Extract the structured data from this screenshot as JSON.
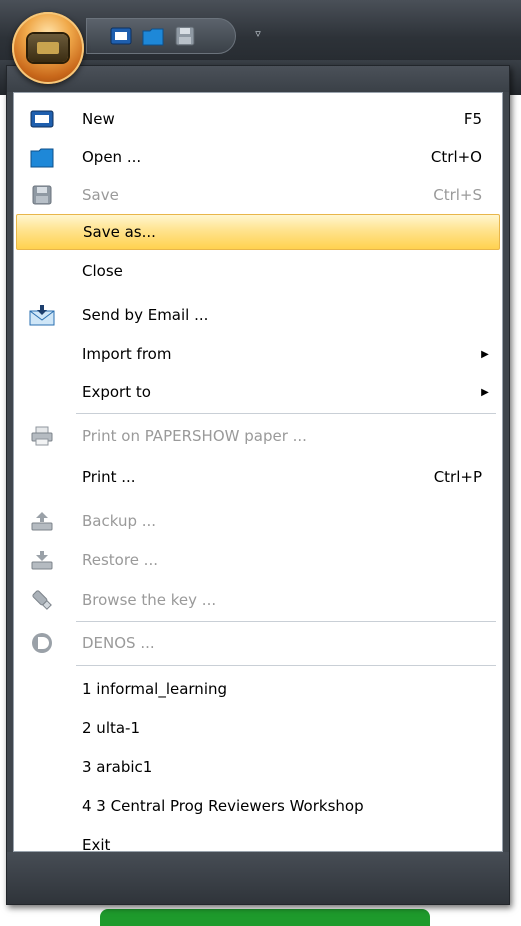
{
  "app": {
    "colors": {
      "highlight": "#ffd24f",
      "chrome": "#2d3238",
      "disabled_text": "#9a9a9a"
    }
  },
  "quick_access": {
    "buttons": [
      {
        "icon": "new-document-icon"
      },
      {
        "icon": "open-folder-icon"
      },
      {
        "icon": "save-disk-icon"
      }
    ],
    "dropdown_icon": "customize-toolbar-arrow-icon"
  },
  "menu": {
    "items": [
      {
        "label": "New",
        "shortcut": "F5",
        "icon": "new-document-icon",
        "enabled": true
      },
      {
        "label": "Open ...",
        "shortcut": "Ctrl+O",
        "icon": "open-folder-icon",
        "enabled": true
      },
      {
        "label": "Save",
        "shortcut": "Ctrl+S",
        "icon": "save-disk-icon",
        "enabled": false
      },
      {
        "label": "Save as...",
        "shortcut": "",
        "enabled": true,
        "highlighted": true
      },
      {
        "label": "Close",
        "shortcut": "",
        "enabled": true
      },
      {
        "label": "Send by Email ...",
        "shortcut": "",
        "icon": "email-icon",
        "enabled": true
      },
      {
        "label": "Import from",
        "submenu": true,
        "enabled": true
      },
      {
        "label": "Export to",
        "submenu": true,
        "enabled": true
      },
      {
        "label": "Print on PAPERSHOW paper ...",
        "icon": "printer-icon",
        "enabled": false
      },
      {
        "label": "Print ...",
        "shortcut": "Ctrl+P",
        "enabled": true
      },
      {
        "label": "Backup ...",
        "icon": "backup-icon",
        "enabled": false
      },
      {
        "label": "Restore ...",
        "icon": "restore-icon",
        "enabled": false
      },
      {
        "label": "Browse the key ...",
        "icon": "usb-key-icon",
        "enabled": false
      },
      {
        "label": "DENOS ...",
        "icon": "denos-icon",
        "enabled": false
      },
      {
        "label": "1 informal_learning",
        "enabled": true
      },
      {
        "label": "2 ulta-1",
        "enabled": true
      },
      {
        "label": "3 arabic1",
        "enabled": true
      },
      {
        "label": "4 3 Central Prog Reviewers Workshop",
        "enabled": true
      },
      {
        "label": "Exit",
        "enabled": true
      }
    ]
  }
}
